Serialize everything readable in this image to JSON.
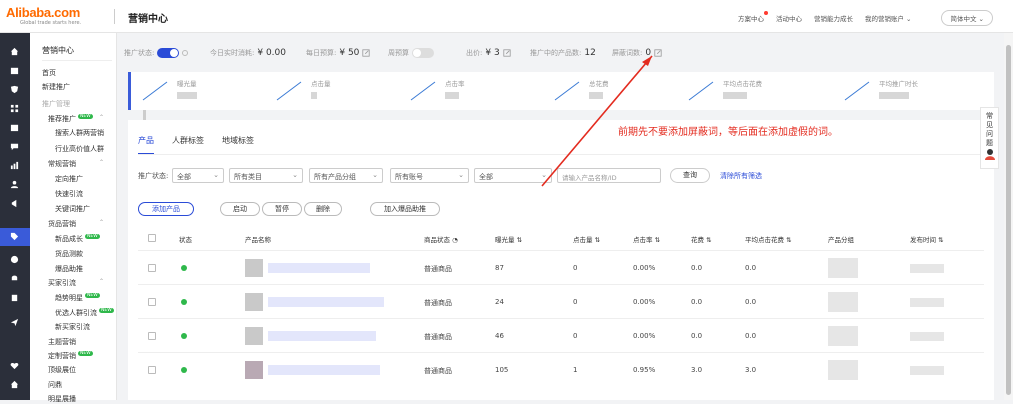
{
  "header": {
    "logo_main": "Alibaba.com",
    "logo_sub": "Global trade starts here.",
    "app_title": "营销中心",
    "nav": [
      "方案中心",
      "活动中心",
      "营销能力成长",
      "我的营销账户"
    ],
    "language": "简体中文"
  },
  "sidebar": {
    "title": "营销中心",
    "items": [
      {
        "label": "首页"
      },
      {
        "label": "新建推广"
      },
      {
        "label": "推广管理"
      },
      {
        "label": "推荐推广",
        "badge": "NEW"
      },
      {
        "label": "搜索人群两营销"
      },
      {
        "label": "行业高价值人群"
      },
      {
        "label": "常规营销"
      },
      {
        "label": "定向推广"
      },
      {
        "label": "快速引流"
      },
      {
        "label": "关键词推广"
      },
      {
        "label": "货品营销"
      },
      {
        "label": "新品成长",
        "badge": "NEW"
      },
      {
        "label": "货品测款"
      },
      {
        "label": "爆品助推"
      },
      {
        "label": "买家引流"
      },
      {
        "label": "趋势明星",
        "badge": "NEW"
      },
      {
        "label": "优选人群引流",
        "badge": "NEW"
      },
      {
        "label": "新买家引流"
      },
      {
        "label": "主题营销"
      },
      {
        "label": "定制营销",
        "badge": "NEW"
      },
      {
        "label": "顶级展位"
      },
      {
        "label": "问鼎"
      },
      {
        "label": "明星展播"
      }
    ]
  },
  "status": {
    "promo_status_label": "推广状态:",
    "today_spend_label": "今日实时消耗:",
    "today_spend_value": "¥ 0.00",
    "daily_budget_label": "每日预算:",
    "daily_budget_value": "¥ 50",
    "smart_budget_label": "周预算",
    "bid_label": "出价:",
    "bid_value": "¥ 3",
    "products_label": "推广中的产品数:",
    "products_value": "12",
    "blocked_label": "屏蔽词数:",
    "blocked_value": "0"
  },
  "metrics": [
    {
      "label": "曝光量"
    },
    {
      "label": "点击量"
    },
    {
      "label": "点击率"
    },
    {
      "label": "总花费"
    },
    {
      "label": "平均点击花费"
    },
    {
      "label": "平均推广时长"
    }
  ],
  "tabs": [
    {
      "label": "产品",
      "active": true
    },
    {
      "label": "人群标签",
      "active": false
    },
    {
      "label": "地域标签",
      "active": false
    }
  ],
  "filters": {
    "status_label": "推广状态:",
    "status_value": "全部",
    "category": "所有类目",
    "group": "所有产品分组",
    "account": "所有账号",
    "scope": "全部",
    "search_placeholder": "请输入产品名称/ID",
    "search_button": "查询",
    "clear_link": "清除所有筛选"
  },
  "actions": {
    "add_product": "添加产品",
    "enable": "启动",
    "pause": "暂停",
    "delete": "删除",
    "boost": "加入爆品助推"
  },
  "table": {
    "columns": [
      "状态",
      "产品名称",
      "商品状态",
      "曝光量",
      "点击量",
      "点击率",
      "花费",
      "平均点击花费",
      "产品分组",
      "发布时间"
    ],
    "rows": [
      {
        "type": "普通商品",
        "impressions": "87",
        "clicks": "0",
        "ctr": "0.00%",
        "cost": "0.0",
        "cpc": "0.0"
      },
      {
        "type": "普通商品",
        "impressions": "24",
        "clicks": "0",
        "ctr": "0.00%",
        "cost": "0.0",
        "cpc": "0.0"
      },
      {
        "type": "普通商品",
        "impressions": "46",
        "clicks": "0",
        "ctr": "0.00%",
        "cost": "0.0",
        "cpc": "0.0"
      },
      {
        "type": "普通商品",
        "impressions": "105",
        "clicks": "1",
        "ctr": "0.95%",
        "cost": "3.0",
        "cpc": "3.0"
      }
    ]
  },
  "annotation": "前期先不要添加屏蔽词，等后面在添加虚假的词。",
  "help": [
    "常",
    "见",
    "问",
    "题"
  ],
  "colors": {
    "primary": "#2a4bd7",
    "brand": "#ff6a00",
    "annotation": "#e32b1f",
    "status_on": "#2fb84b"
  }
}
